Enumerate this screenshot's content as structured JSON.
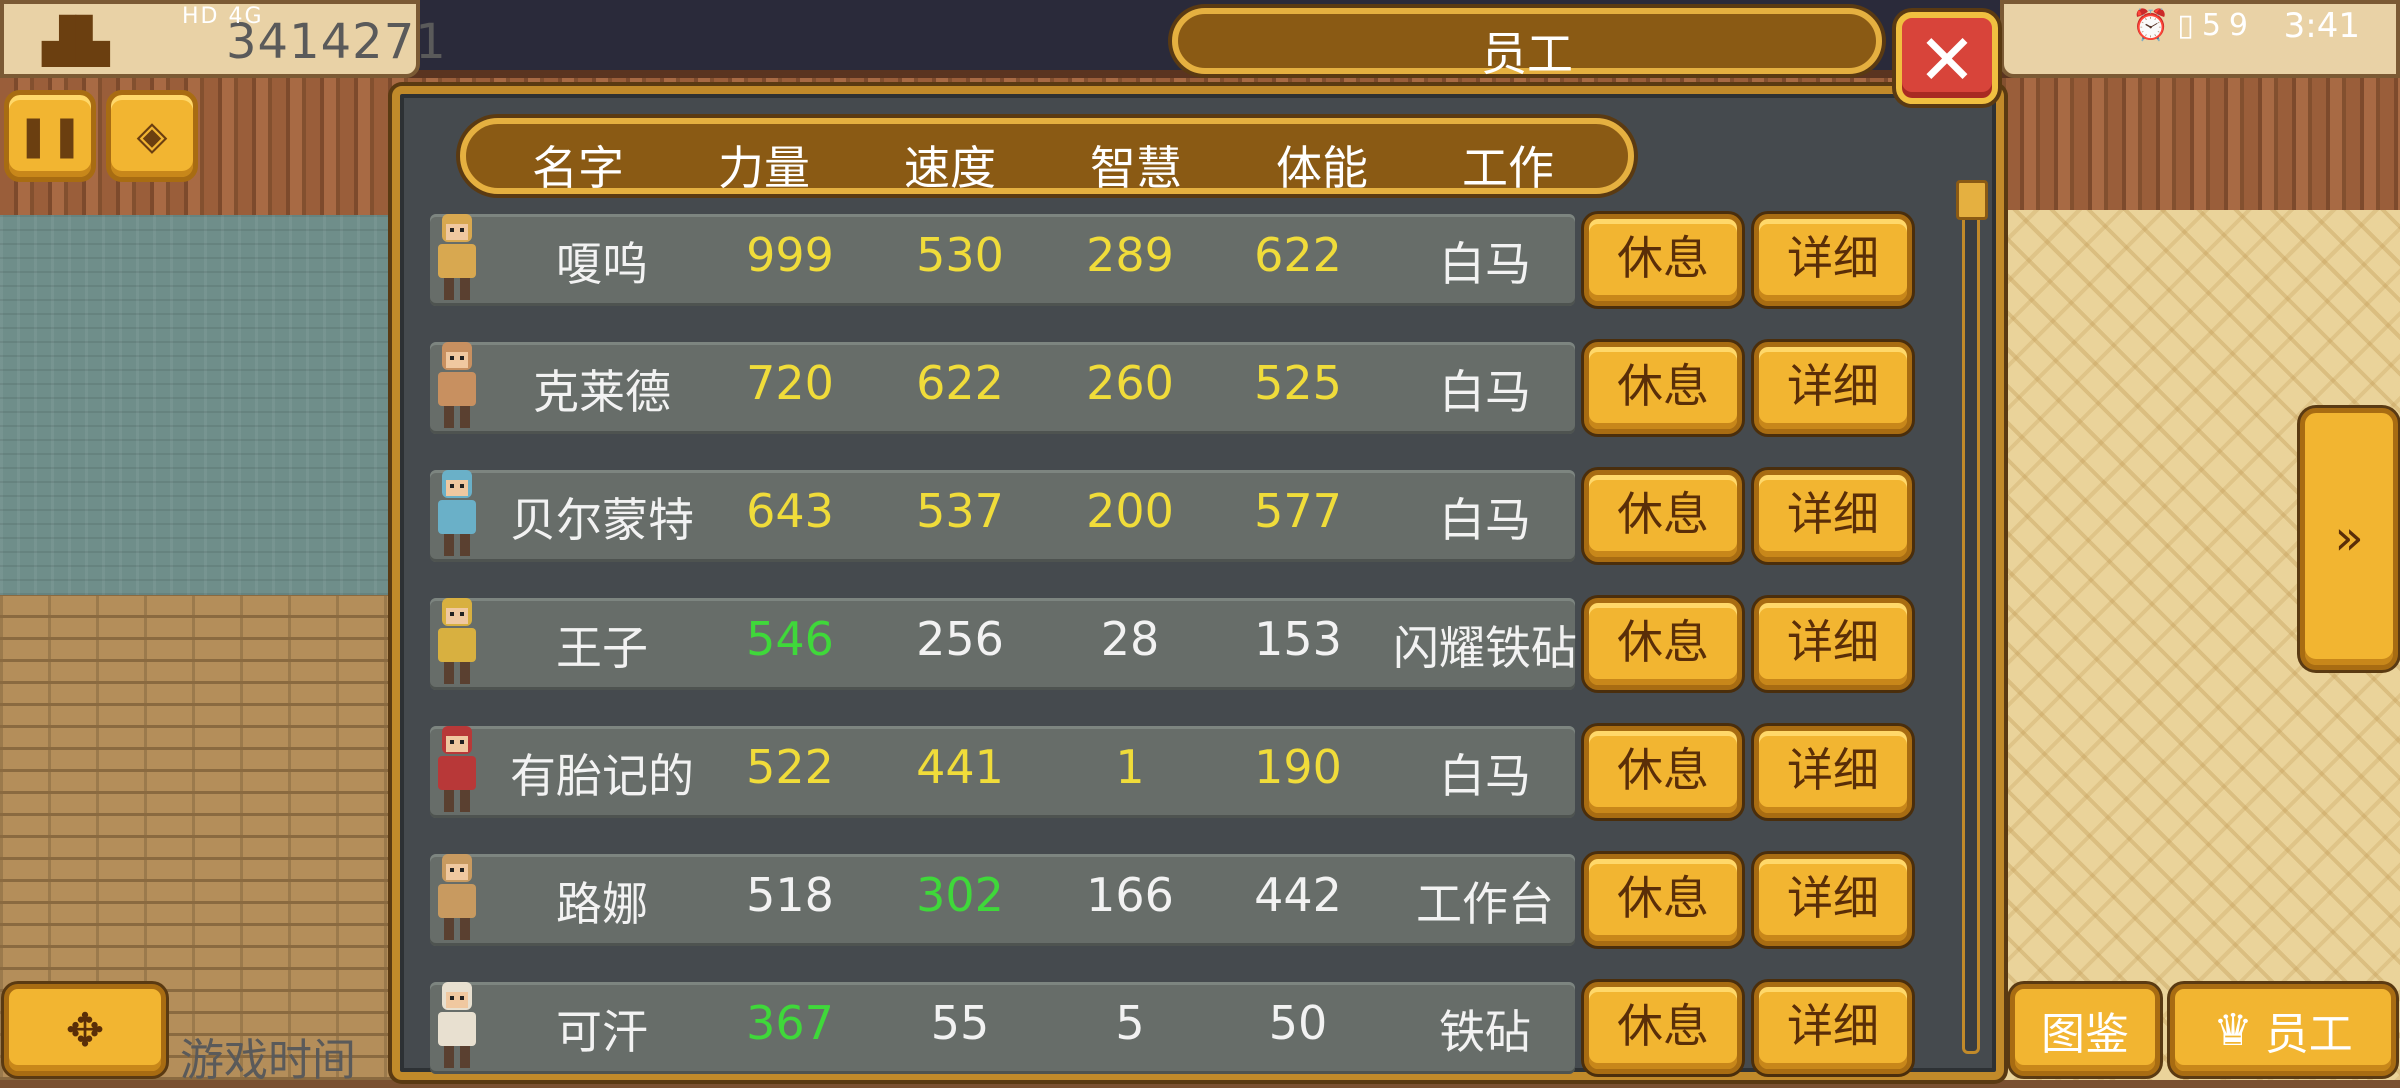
{
  "hud": {
    "money": "3414271",
    "money_icon": "buildings-icon",
    "status_left": "HD 4G",
    "clock": "3:41",
    "battery": "59",
    "pause_icon": "pause-icon",
    "tickets_icon": "tickets-icon"
  },
  "panel": {
    "title": "员工",
    "close_label": "✕"
  },
  "headers": [
    "名字",
    "力量",
    "速度",
    "智慧",
    "体能",
    "工作"
  ],
  "rows": [
    {
      "name": "嗄呜",
      "str": "999",
      "spd": "530",
      "int": "289",
      "sta": "622",
      "job": "白马"
    },
    {
      "name": "克莱德",
      "str": "720",
      "spd": "622",
      "int": "260",
      "sta": "525",
      "job": "白马"
    },
    {
      "name": "贝尔蒙特",
      "str": "643",
      "spd": "537",
      "int": "200",
      "sta": "577",
      "job": "白马"
    },
    {
      "name": "王子",
      "str": "546",
      "spd": "256",
      "int": "28",
      "sta": "153",
      "job": "闪耀铁砧"
    },
    {
      "name": "有胎记的",
      "str": "522",
      "spd": "441",
      "int": "1",
      "sta": "190",
      "job": "白马"
    },
    {
      "name": "路娜",
      "str": "518",
      "spd": "302",
      "int": "166",
      "sta": "442",
      "job": "工作台"
    },
    {
      "name": "可汗",
      "str": "367",
      "spd": "55",
      "int": "5",
      "sta": "50",
      "job": "铁砧"
    }
  ],
  "row_buttons": {
    "rest": "休息",
    "detail": "详细"
  },
  "bottom": {
    "game_time": "游戏时间",
    "catalog": "图鉴",
    "staff": "员工"
  },
  "colors": {
    "stat_yellow": "#f0dc3a",
    "stat_green": "#3fd83a",
    "stat_white": "#f2f2f2",
    "button_gold": "#f2b531",
    "panel_bg": "#454a4e",
    "close_red": "#d8443a"
  }
}
